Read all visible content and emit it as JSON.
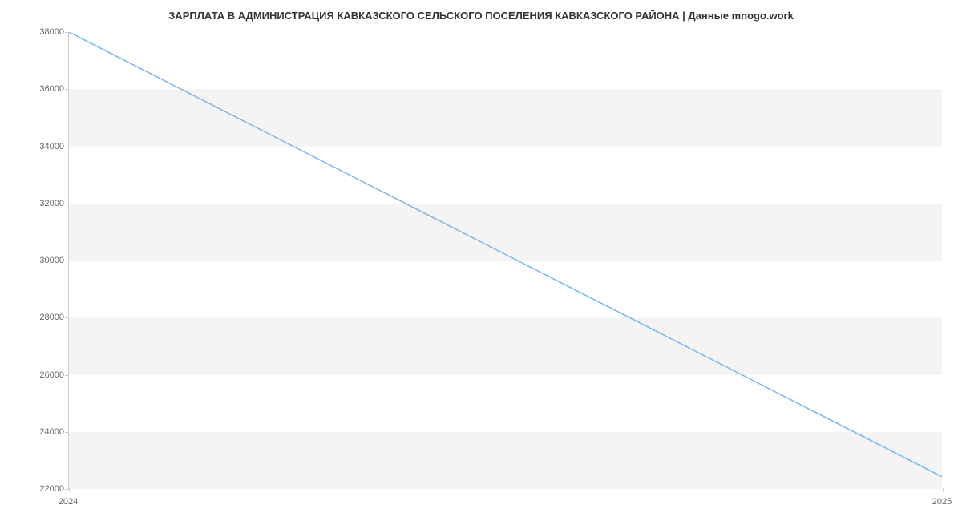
{
  "chart_data": {
    "type": "line",
    "title": "ЗАРПЛАТА В АДМИНИСТРАЦИЯ КАВКАЗСКОГО СЕЛЬСКОГО ПОСЕЛЕНИЯ КАВКАЗСКОГО РАЙОНА | Данные mnogo.work",
    "xlabel": "",
    "ylabel": "",
    "x": [
      2024,
      2025
    ],
    "values": [
      38000,
      22400
    ],
    "x_ticks": [
      2024,
      2025
    ],
    "y_ticks": [
      22000,
      24000,
      26000,
      28000,
      30000,
      32000,
      34000,
      36000,
      38000
    ],
    "ylim": [
      22000,
      38000
    ],
    "xlim": [
      2024,
      2025
    ],
    "line_color": "#7cb5ec"
  }
}
